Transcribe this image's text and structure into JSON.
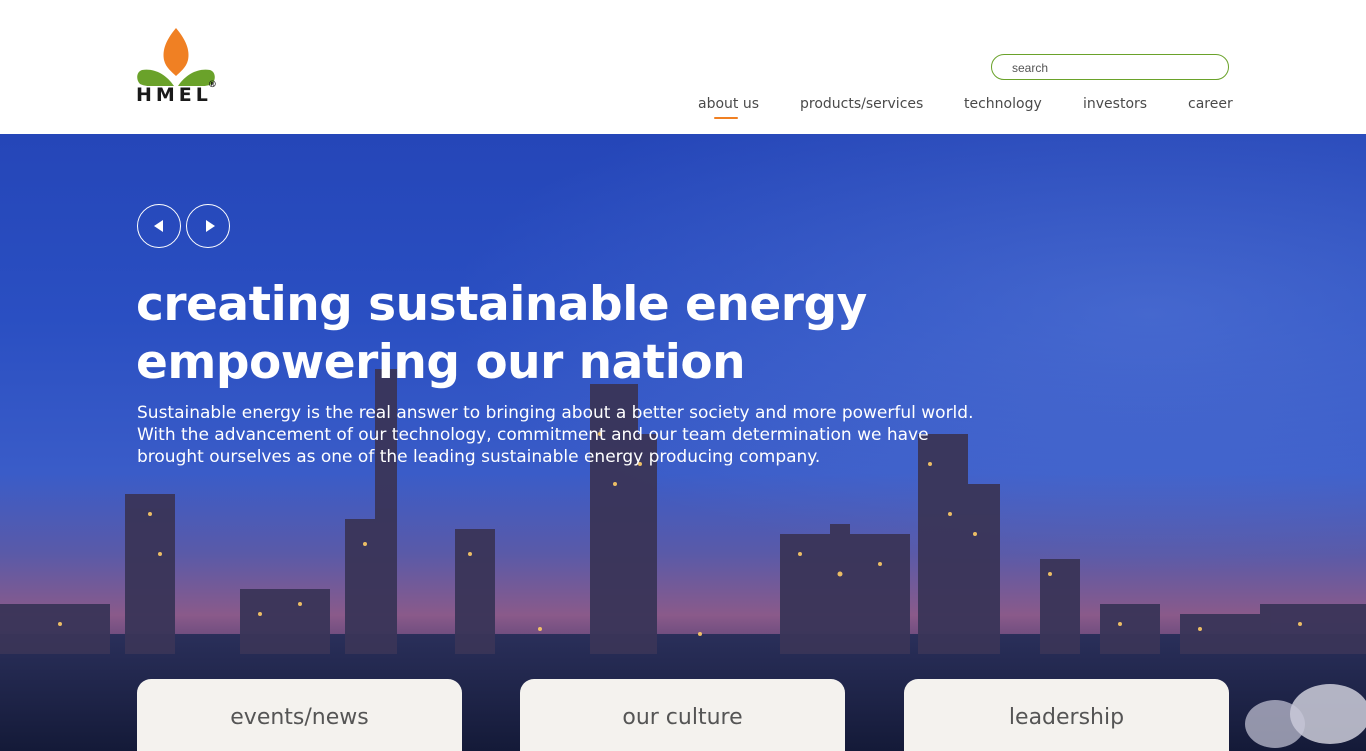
{
  "brand": {
    "name": "HMEL",
    "registered": "®",
    "colors": {
      "orange": "#f08023",
      "green": "#6aa22a"
    }
  },
  "search": {
    "placeholder": "search",
    "value": ""
  },
  "nav": {
    "items": [
      {
        "label": "about us",
        "active": true
      },
      {
        "label": "products/services",
        "active": false
      },
      {
        "label": "technology",
        "active": false
      },
      {
        "label": "investors",
        "active": false
      },
      {
        "label": "career",
        "active": false
      }
    ]
  },
  "hero": {
    "title_line1": "creating sustainable energy",
    "title_line2": "empowering our nation",
    "text": "Sustainable energy is the real answer to bringing about a better society and more powerful world. With the advancement of our technology, commitment and our team determination we have brought ourselves as one of the leading sustainable energy producing company.",
    "prev_icon": "play-left-icon",
    "next_icon": "play-right-icon"
  },
  "cards": [
    {
      "label": "events/news"
    },
    {
      "label": "our culture"
    },
    {
      "label": "leadership"
    }
  ]
}
